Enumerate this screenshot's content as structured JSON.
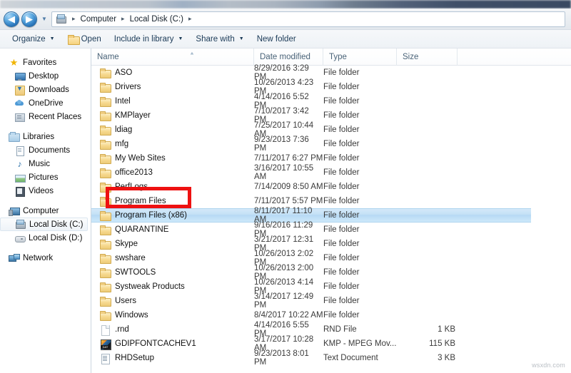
{
  "navigation": {
    "back_icon": "arrow-left-icon",
    "back_glyph": "◀",
    "forward_icon": "arrow-right-icon",
    "forward_glyph": "▶",
    "dropdown_glyph": "▼",
    "address_icon": "local-disk-icon",
    "breadcrumbs": [
      "Computer",
      "Local Disk (C:)"
    ],
    "separator_glyph": "▸"
  },
  "toolbar": {
    "items": [
      {
        "label": "Organize",
        "icon": "",
        "caret": true
      },
      {
        "label": "Open",
        "icon": "folder-icon",
        "caret": false
      },
      {
        "label": "Include in library",
        "icon": "",
        "caret": true
      },
      {
        "label": "Share with",
        "icon": "",
        "caret": true
      },
      {
        "label": "New folder",
        "icon": "",
        "caret": false
      }
    ],
    "caret_glyph": "▼"
  },
  "sidebar": {
    "groups": [
      {
        "header": {
          "label": "Favorites",
          "icon": "star-icon",
          "class": "ico-star",
          "glyph": "★"
        },
        "items": [
          {
            "label": "Desktop",
            "icon": "desktop-icon",
            "class": "ico-desktop"
          },
          {
            "label": "Downloads",
            "icon": "downloads-icon",
            "class": "ico-download"
          },
          {
            "label": "OneDrive",
            "icon": "onedrive-cloud-icon",
            "class": "ico-cloud"
          },
          {
            "label": "Recent Places",
            "icon": "recent-places-icon",
            "class": "ico-recent"
          }
        ]
      },
      {
        "header": {
          "label": "Libraries",
          "icon": "libraries-icon",
          "class": "ico-libraries",
          "glyph": ""
        },
        "items": [
          {
            "label": "Documents",
            "icon": "documents-icon",
            "class": "ico-doc"
          },
          {
            "label": "Music",
            "icon": "music-note-icon",
            "class": "ico-music",
            "glyph": "♪"
          },
          {
            "label": "Pictures",
            "icon": "pictures-icon",
            "class": "ico-picture"
          },
          {
            "label": "Videos",
            "icon": "videos-icon",
            "class": "ico-video"
          }
        ]
      },
      {
        "header": {
          "label": "Computer",
          "icon": "computer-icon",
          "class": "ico-computer",
          "glyph": ""
        },
        "items": [
          {
            "label": "Local Disk (C:)",
            "icon": "hard-drive-icon",
            "class": "ico-hdd",
            "selected": true
          },
          {
            "label": "Local Disk (D:)",
            "icon": "hard-drive-icon",
            "class": "ico-hdd2",
            "selected": false
          }
        ]
      },
      {
        "header": {
          "label": "Network",
          "icon": "network-icon",
          "class": "ico-network",
          "glyph": ""
        },
        "items": []
      }
    ]
  },
  "file_list": {
    "columns": [
      "Name",
      "Date modified",
      "Type",
      "Size"
    ],
    "sort_arrow_glyph": "▲",
    "rows": [
      {
        "name": "ASO",
        "date": "8/29/2016 3:29 PM",
        "type": "File folder",
        "size": "",
        "icon": "folder-icon",
        "icon_class": "f-folder"
      },
      {
        "name": "Drivers",
        "date": "10/26/2013 4:23 PM",
        "type": "File folder",
        "size": "",
        "icon": "folder-icon",
        "icon_class": "f-folder"
      },
      {
        "name": "Intel",
        "date": "4/14/2016 5:52 PM",
        "type": "File folder",
        "size": "",
        "icon": "folder-icon",
        "icon_class": "f-folder"
      },
      {
        "name": "KMPlayer",
        "date": "7/10/2017 3:42 PM",
        "type": "File folder",
        "size": "",
        "icon": "folder-icon",
        "icon_class": "f-folder"
      },
      {
        "name": "ldiag",
        "date": "7/25/2017 10:44 AM",
        "type": "File folder",
        "size": "",
        "icon": "folder-icon",
        "icon_class": "f-folder"
      },
      {
        "name": "mfg",
        "date": "9/23/2013 7:36 PM",
        "type": "File folder",
        "size": "",
        "icon": "folder-icon",
        "icon_class": "f-folder"
      },
      {
        "name": "My Web Sites",
        "date": "7/11/2017 6:27 PM",
        "type": "File folder",
        "size": "",
        "icon": "folder-icon",
        "icon_class": "f-folder"
      },
      {
        "name": "office2013",
        "date": "3/16/2017 10:55 AM",
        "type": "File folder",
        "size": "",
        "icon": "folder-icon",
        "icon_class": "f-folder"
      },
      {
        "name": "PerfLogs",
        "date": "7/14/2009 8:50 AM",
        "type": "File folder",
        "size": "",
        "icon": "folder-icon",
        "icon_class": "f-folder"
      },
      {
        "name": "Program Files",
        "date": "7/11/2017 5:57 PM",
        "type": "File folder",
        "size": "",
        "icon": "folder-icon",
        "icon_class": "f-folder"
      },
      {
        "name": "Program Files (x86)",
        "date": "8/11/2017 11:10 AM",
        "type": "File folder",
        "size": "",
        "icon": "folder-icon",
        "icon_class": "f-folder",
        "selected": true
      },
      {
        "name": "QUARANTINE",
        "date": "9/16/2016 11:29 PM",
        "type": "File folder",
        "size": "",
        "icon": "folder-icon",
        "icon_class": "f-folder"
      },
      {
        "name": "Skype",
        "date": "3/21/2017 12:31 PM",
        "type": "File folder",
        "size": "",
        "icon": "folder-icon",
        "icon_class": "f-folder"
      },
      {
        "name": "swshare",
        "date": "10/26/2013 2:02 PM",
        "type": "File folder",
        "size": "",
        "icon": "folder-icon",
        "icon_class": "f-folder"
      },
      {
        "name": "SWTOOLS",
        "date": "10/26/2013 2:00 PM",
        "type": "File folder",
        "size": "",
        "icon": "folder-icon",
        "icon_class": "f-folder"
      },
      {
        "name": "Systweak Products",
        "date": "10/26/2013 4:14 PM",
        "type": "File folder",
        "size": "",
        "icon": "folder-icon",
        "icon_class": "f-folder"
      },
      {
        "name": "Users",
        "date": "3/14/2017 12:49 PM",
        "type": "File folder",
        "size": "",
        "icon": "folder-icon",
        "icon_class": "f-folder"
      },
      {
        "name": "Windows",
        "date": "8/4/2017 10:22 AM",
        "type": "File folder",
        "size": "",
        "icon": "folder-icon",
        "icon_class": "f-folder"
      },
      {
        "name": ".rnd",
        "date": "4/14/2016 5:55 PM",
        "type": "RND File",
        "size": "1 KB",
        "icon": "blank-file-icon",
        "icon_class": "f-blank"
      },
      {
        "name": "GDIPFONTCACHEV1",
        "date": "3/17/2017 10:28 AM",
        "type": "KMP - MPEG Mov...",
        "size": "115 KB",
        "icon": "media-file-icon",
        "icon_class": "f-media"
      },
      {
        "name": "RHDSetup",
        "date": "9/23/2013 8:01 PM",
        "type": "Text Document",
        "size": "3 KB",
        "icon": "text-document-icon",
        "icon_class": "f-text"
      }
    ]
  },
  "annotation": {
    "highlight_color": "#ee1111",
    "target_row": "Program Files (x86)"
  },
  "watermark": {
    "text": "wsxdn.com"
  }
}
